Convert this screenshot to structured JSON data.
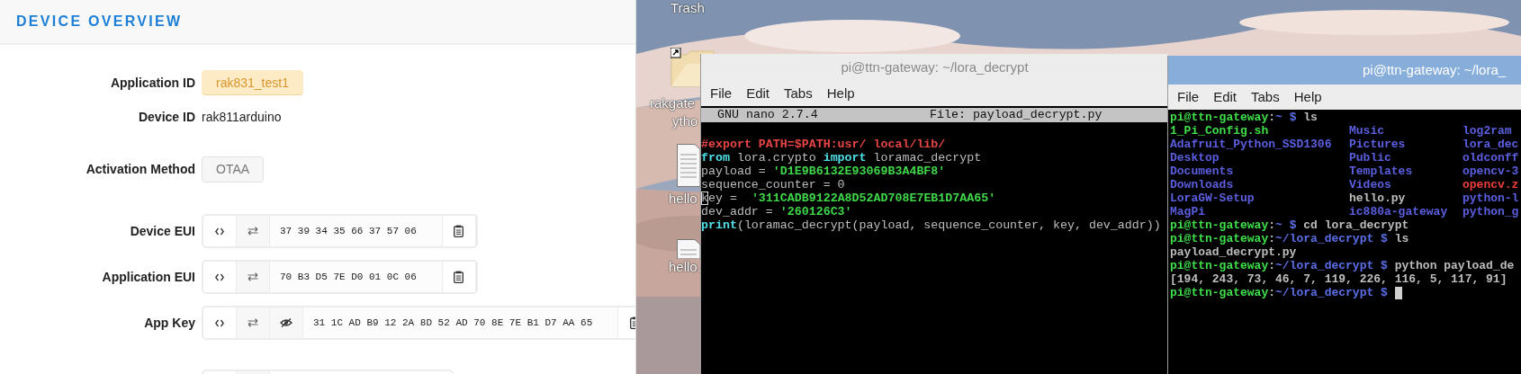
{
  "overview": {
    "title": "DEVICE OVERVIEW",
    "rows": [
      {
        "kind": "badge",
        "label": "Application ID",
        "value": "rak831_test1"
      },
      {
        "kind": "plain",
        "label": "Device ID",
        "value": "rak811arduino"
      },
      {
        "kind": "tag",
        "label": "Activation Method",
        "value": "OTAA"
      },
      {
        "kind": "key",
        "label": "Device EUI",
        "tools": [
          {
            "kind": "code"
          },
          {
            "kind": "swap"
          }
        ],
        "value": "37 39 34 35 66 37 57 06"
      },
      {
        "kind": "key",
        "label": "Application EUI",
        "tools": [
          {
            "kind": "code"
          },
          {
            "kind": "swap"
          }
        ],
        "value": "70 B3 D5 7E D0 01 0C 06"
      },
      {
        "kind": "key",
        "label": "App Key",
        "tools": [
          {
            "kind": "code"
          },
          {
            "kind": "swap"
          },
          {
            "kind": "hide"
          }
        ],
        "value": "31 1C AD B9 12 2A 8D 52 AD 70 8E 7E B1 D7 AA 65"
      },
      {
        "kind": "stub"
      }
    ]
  },
  "desktop": {
    "icons": [
      {
        "kind": "trash",
        "lines": [
          "Trash"
        ]
      },
      {
        "kind": "folder",
        "lines": [
          "rakgate",
          "ytho"
        ]
      },
      {
        "kind": "file",
        "lines": [
          "hello"
        ]
      },
      {
        "kind": "file",
        "lines": [
          "hello."
        ]
      }
    ]
  },
  "nano_window": {
    "title": "pi@ttn-gateway: ~/lora_decrypt",
    "menu": [
      "File",
      "Edit",
      "Tabs",
      "Help"
    ],
    "header_left": "GNU nano 2.7.4",
    "header_right": "File: payload_decrypt.py",
    "lines": [
      {
        "segments": [
          {
            "text": "#export PATH=$PATH:usr/ local/lib/",
            "kind": "comment"
          }
        ]
      },
      {
        "segments": [
          {
            "text": "from",
            "kind": "keyword"
          },
          {
            "text": " lora.crypto ",
            "kind": "plain"
          },
          {
            "text": "import",
            "kind": "keyword"
          },
          {
            "text": " loramac_decrypt",
            "kind": "plain"
          }
        ]
      },
      {
        "segments": [
          {
            "text": "payload = ",
            "kind": "plain"
          },
          {
            "text": "'D1E9B6132E93069B3A4BF8'",
            "kind": "string"
          }
        ]
      },
      {
        "segments": [
          {
            "text": "sequence_counter = 0",
            "kind": "plain"
          }
        ]
      },
      {
        "segments": [
          {
            "text": "k",
            "kind": "cursor"
          },
          {
            "text": "ey =  ",
            "kind": "plain"
          },
          {
            "text": "'311CADB9122A8D52AD708E7EB1D7AA65'",
            "kind": "string"
          }
        ]
      },
      {
        "segments": [
          {
            "text": "dev_addr = ",
            "kind": "plain"
          },
          {
            "text": "'260126C3'",
            "kind": "string"
          }
        ]
      },
      {
        "segments": [
          {
            "text": "print",
            "kind": "keyword"
          },
          {
            "text": "(loramac_decrypt(payload, sequence_counter, key, dev_addr))",
            "kind": "plain"
          }
        ]
      }
    ]
  },
  "terminal_window": {
    "title": "pi@ttn-gateway: ~/lora_",
    "menu": [
      "File",
      "Edit",
      "Tabs",
      "Help"
    ],
    "lines": [
      {
        "kind": "text",
        "segments": [
          {
            "text": "pi@ttn-gateway",
            "kind": "user"
          },
          {
            "text": ":",
            "kind": "plain"
          },
          {
            "text": "~ $",
            "kind": "path"
          },
          {
            "text": " ls",
            "kind": "plain"
          }
        ]
      },
      {
        "kind": "columns",
        "cells": [
          {
            "text": "1_Pi_Config.sh",
            "kind": "exec"
          },
          {
            "text": "Music",
            "kind": "dir"
          },
          {
            "text": "log2ram",
            "kind": "dir"
          }
        ]
      },
      {
        "kind": "columns",
        "cells": [
          {
            "text": "Adafruit_Python_SSD1306",
            "kind": "dir"
          },
          {
            "text": "Pictures",
            "kind": "dir"
          },
          {
            "text": "lora_dec",
            "kind": "dir"
          }
        ]
      },
      {
        "kind": "columns",
        "cells": [
          {
            "text": "Desktop",
            "kind": "dir"
          },
          {
            "text": "Public",
            "kind": "dir"
          },
          {
            "text": "oldconff",
            "kind": "dir"
          }
        ]
      },
      {
        "kind": "columns",
        "cells": [
          {
            "text": "Documents",
            "kind": "dir"
          },
          {
            "text": "Templates",
            "kind": "dir"
          },
          {
            "text": "opencv-3",
            "kind": "dir"
          }
        ]
      },
      {
        "kind": "columns",
        "cells": [
          {
            "text": "Downloads",
            "kind": "dir"
          },
          {
            "text": "Videos",
            "kind": "dir"
          },
          {
            "text": "opencv.z",
            "kind": "archive"
          }
        ]
      },
      {
        "kind": "columns",
        "cells": [
          {
            "text": "LoraGW-Setup",
            "kind": "dir"
          },
          {
            "text": "hello.py",
            "kind": "plain"
          },
          {
            "text": "python-l",
            "kind": "dir"
          }
        ]
      },
      {
        "kind": "columns",
        "cells": [
          {
            "text": "MagPi",
            "kind": "dir"
          },
          {
            "text": "ic880a-gateway",
            "kind": "dir"
          },
          {
            "text": "python_g",
            "kind": "dir"
          }
        ]
      },
      {
        "kind": "text",
        "segments": [
          {
            "text": "pi@ttn-gateway",
            "kind": "user"
          },
          {
            "text": ":",
            "kind": "plain"
          },
          {
            "text": "~ $",
            "kind": "path"
          },
          {
            "text": " cd lora_decrypt",
            "kind": "plain"
          }
        ]
      },
      {
        "kind": "text",
        "segments": [
          {
            "text": "pi@ttn-gateway",
            "kind": "user"
          },
          {
            "text": ":",
            "kind": "plain"
          },
          {
            "text": "~/lora_decrypt $",
            "kind": "path"
          },
          {
            "text": " ls",
            "kind": "plain"
          }
        ]
      },
      {
        "kind": "text",
        "segments": [
          {
            "text": "payload_decrypt.py",
            "kind": "plain"
          }
        ]
      },
      {
        "kind": "text",
        "segments": [
          {
            "text": "pi@ttn-gateway",
            "kind": "user"
          },
          {
            "text": ":",
            "kind": "plain"
          },
          {
            "text": "~/lora_decrypt $",
            "kind": "path"
          },
          {
            "text": " python payload_de",
            "kind": "plain"
          }
        ]
      },
      {
        "kind": "text",
        "segments": [
          {
            "text": "[194, 243, 73, 46, 7, 119, 226, 116, 5, 117, 91]",
            "kind": "plain"
          }
        ]
      },
      {
        "kind": "text",
        "cursor": true,
        "segments": [
          {
            "text": "pi@ttn-gateway",
            "kind": "user"
          },
          {
            "text": ":",
            "kind": "plain"
          },
          {
            "text": "~/lora_decrypt $",
            "kind": "path"
          }
        ]
      }
    ]
  }
}
